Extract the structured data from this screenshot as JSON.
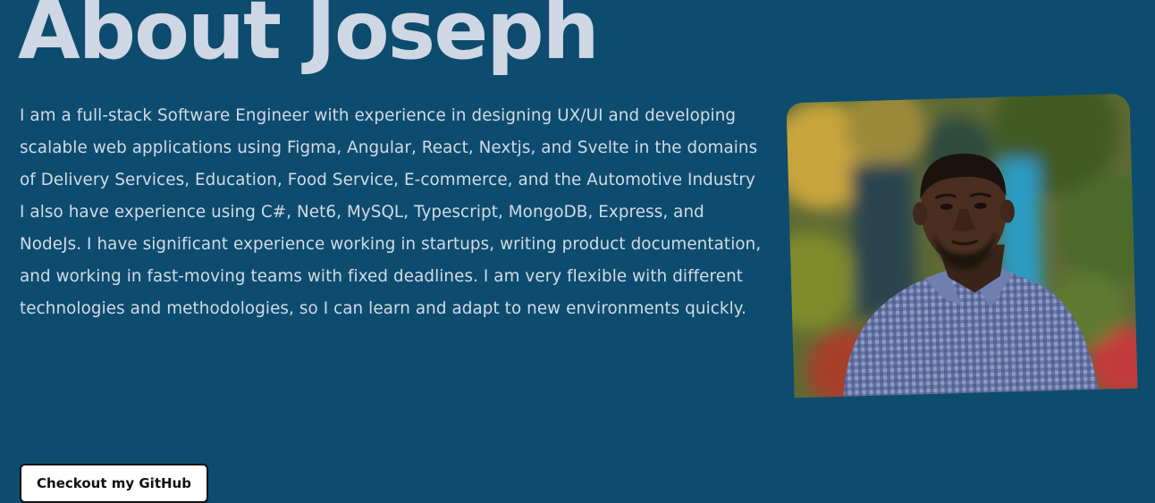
{
  "about": {
    "heading": "About Joseph",
    "bio": "I am a full-stack Software Engineer with experience in designing UX/UI and developing scalable web applications using Figma, Angular, React, Nextjs, and Svelte in the domains of Delivery Services, Education, Food Service, E-commerce, and the Automotive Industry I also have experience using C#, Net6, MySQL, Typescript, MongoDB, Express, and NodeJs. I have significant experience working in startups, writing product documentation, and working in fast-moving teams with fixed deadlines. I am very flexible with different technologies and methodologies, so I can learn and adapt to new environments quickly.",
    "github_button_label": "Checkout my GitHub"
  },
  "colors": {
    "background": "#0d4c6f",
    "heading": "#cfd6e4",
    "body_text": "#d3dae6",
    "button_bg": "#ffffff",
    "button_text": "#111111"
  }
}
